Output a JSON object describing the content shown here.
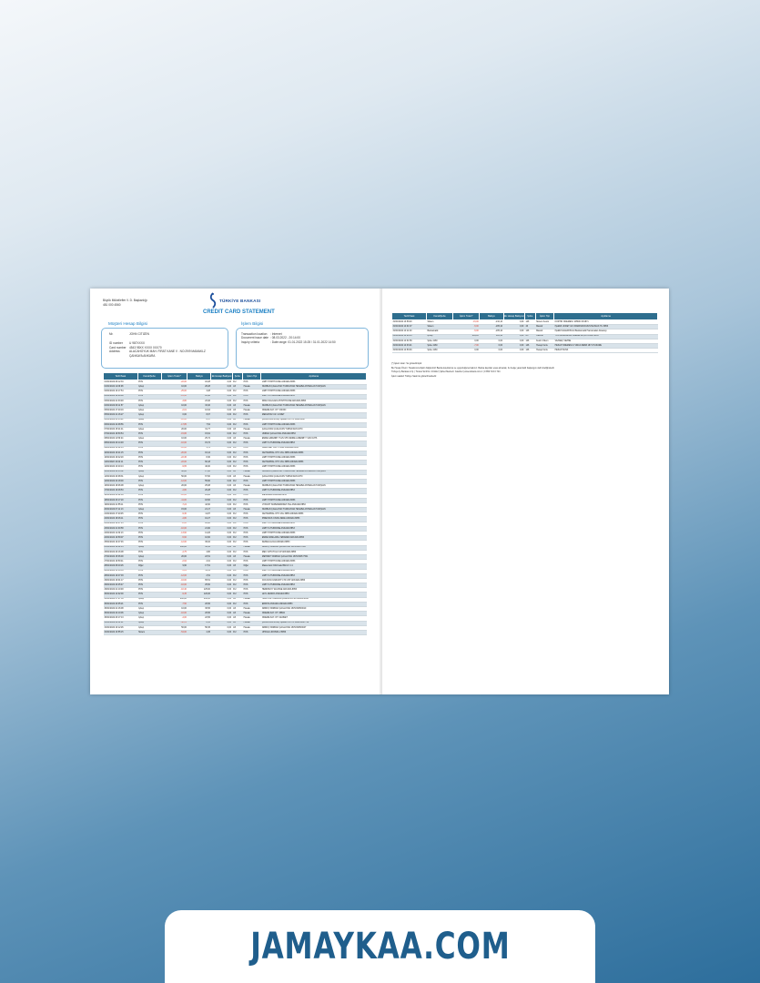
{
  "issuer": {
    "line1": "Büyük Mükellefler V. D. Başkanlığı",
    "line2": "481 000 4560"
  },
  "logo": {
    "text": "TÜRKİYE BANKASI",
    "icon": "bank-logo-icon",
    "color": "#1c4f9c"
  },
  "title": "CREDIT CARD STATEMENT",
  "customer_box": {
    "title": "Müşteri Hesap Bilgisi",
    "name_label": "Mr.",
    "name_value": "JOHN CITIZEN",
    "id_label": "ID number",
    "id_value": "U 987XXXX",
    "card_label": "Card number",
    "card_value": "4543 98XX XXXX 0XX70",
    "address_label": "Address",
    "address_value": "ALACAHOYUK MAH. FIRAT KANE V . NO:29/9 MAMAKLZ ÇANKAYA ANKARA"
  },
  "statement_box": {
    "title": "İşlem Bilgisi",
    "location_label": "Transaction location",
    "location_value": ": Internet",
    "issue_label": "Document issue date",
    "issue_value": ": 08.03.2022 - 20:14:00",
    "criteria_label": "Inquiry criteria",
    "criteria_value": ": Date range: 01.01.2022 15:25 / 31.01.2022 14:50"
  },
  "columns": [
    "Tarih/Saat",
    "Kanal/Şube",
    "İşlem Tutarı*",
    "Bakiye",
    "Ek Hesap Bakiyesi",
    "Şube",
    "İşlem Tipi",
    "Açıklama"
  ],
  "rows": [
    [
      "01/01/2022 09:12:33",
      "POS",
      "-22,00",
      "18,28",
      "0,00",
      "DU",
      "POS",
      "LIMIT POSTHOUSE ANKARA 8653"
    ],
    [
      "01/01/2022 11:06:08",
      "İşCep",
      "10,00",
      "28,28",
      "0,00",
      "AX",
      "Havale",
      "NURBAN ÇAĞLAYAN TURNA'DAN HESABA ANTARLAN TAKIŞGİN"
    ],
    [
      "02/01/2022 10:17:54",
      "POS",
      "-25,00",
      "3,28",
      "0,00",
      "DU",
      "POS",
      "LIMIT POSTHOUSE ANKARA 8653"
    ],
    [
      "03/01/2022 18:28:08",
      "POS",
      "-13,60",
      "10,40",
      "0,00",
      "DU",
      "POS",
      "LIMIT FUTURPANE ANKARA 8853"
    ],
    [
      "03/01/2022 21:33:48",
      "POS",
      "-3,80",
      "23,40",
      "0,00",
      "DU",
      "POS",
      "DIMLI DALILAKA POSTHOUSE ANKARA 8853"
    ],
    [
      "04/01/2022 09:11:57",
      "İşCep",
      "10,00",
      "33,40",
      "0,00",
      "AX",
      "Havale",
      "NURBAN ÇAĞLAYAN TURNA'DAN HESABA ANTARLAN TAKIŞGİN"
    ],
    [
      "05/01/2022 17:40:19",
      "İşCep",
      "-2,01",
      "10,64",
      "0,00",
      "AX",
      "Havale",
      "ÖDEME KAY. OT: VISION"
    ],
    [
      "05/01/2022 21:16:27",
      "İşCep",
      "0,00",
      "8,07",
      "0,00",
      "DU",
      "POS",
      "MEDIAHAV UZ. UCRET"
    ],
    [
      "06/01/2022 21:15:21",
      "İşCep",
      "-10,00",
      "8,17",
      "0,00",
      "AX",
      "Havale",
      "ÇAĞLAYAN BORÇ İŞLEMİ OUT IL 1188/3580"
    ],
    [
      "06/01/2022 22:08:56",
      "POS",
      "-17,85",
      "7,54",
      "0,00",
      "DU",
      "POS",
      "LIMIT POSTHOUSE ANKARA 8653"
    ],
    [
      "07/01/2022 15:21:41",
      "İşCep",
      "20,00",
      "31,77",
      "0,00",
      "AX",
      "Havale",
      "ÇAĞLAYAN ÇAĞLAYAN TURNA'DAN 1870"
    ],
    [
      "07/01/2022 18:50:54",
      "POS",
      "-15,86",
      "15,91",
      "0,00",
      "DU",
      "POS",
      "UMRAN ÇAĞLAYAN ANKARA 8853"
    ],
    [
      "08/01/2022 11:50:24",
      "İşCep",
      "10,00",
      "25,72",
      "0,00",
      "AX",
      "Havale",
      "EMRE AJRENBY YÜZÜ VP2 EMRE AJRENBY YÜZÜ 1876"
    ],
    [
      "08/01/2022 20:14:48",
      "POS",
      "-10,00",
      "15,72",
      "0,00",
      "DU",
      "POS",
      "LIMIT FUTURPANE ANKARA 8853"
    ],
    [
      "09/01/2022 13:42:13",
      "POS",
      "-10,00",
      "5,72",
      "0,00",
      "DU",
      "POS",
      "ÖREN BEY BAY 3 SOR ANKARA 8853"
    ],
    [
      "10/01/2022 16:21:15",
      "POS",
      "-20,00",
      "16,12",
      "0,00",
      "DU",
      "POS",
      "CEYNEPRAL OTO VAL 3985 ANKARA 8853"
    ],
    [
      "10/01/2022 19:42:20",
      "POS",
      "-22,36",
      "8,30",
      "0,00",
      "DU",
      "POS",
      "LIMIT POSTHOUSE ANKARA 8653"
    ],
    [
      "11/01/2022 10:22:11",
      "POS",
      "-22,00",
      "60,18",
      "0,00",
      "DU",
      "POS",
      "CEYNEPRAL OTO VAL 3985 ANKARA 8853"
    ],
    [
      "12/01/2022 13:40:13",
      "POS",
      "-9,65",
      "40,00",
      "0,00",
      "DU",
      "POS",
      "LIMIT POSTHOUSE ANKARA 8653"
    ],
    [
      "13/01/2022 20:13:32",
      "İşCep",
      "60,00",
      "17,60",
      "0,00",
      "AX",
      "Havale",
      "NURBAN ÇAĞLAYAN TURNA'DAN HESABA ANTARLAN TAKIŞGİN"
    ],
    [
      "14/01/2022 20:08:31",
      "İşCep",
      "50,00",
      "67,60",
      "0,00",
      "AX",
      "Havale",
      "ÇAĞLAYAN ÇAĞLAYAN TURNA'DAN 1870"
    ],
    [
      "14/01/2022 22:18:00",
      "POS",
      "-12,00",
      "55,60",
      "0,00",
      "DU",
      "POS",
      "LIMIT POSTHOUSE ANKARA 8653"
    ],
    [
      "16/01/2022 18:06:08",
      "İşCep",
      "20,00",
      "25,08",
      "0,00",
      "AX",
      "Havale",
      "NURBAN ÇAĞLAYAN TURNA'DAN HESABA ANTARLAN TAKIŞGİN"
    ],
    [
      "17/01/2022 19:48:53",
      "POS",
      "-4,80",
      "20,28",
      "0,00",
      "DU",
      "POS",
      "LIMIT FUTURPANE ANKARA 8853"
    ],
    [
      "18/01/2022 23:02:06",
      "POS",
      "-10,00",
      "29,60",
      "0,00",
      "DU",
      "POS",
      "MESAMBA ANKARA 8853"
    ],
    [
      "18/01/2022 23:17:20",
      "POS",
      "-11,00",
      "18,60",
      "0,00",
      "DU",
      "POS",
      "LIMIT POSTHOUSE ANKARA 8653"
    ],
    [
      "19/01/2022 21:55:11",
      "POS",
      "-7,24",
      "42,60",
      "0,00",
      "DU",
      "POS",
      "UYKURT SUPERMARKET-TEL ANKARA 8853"
    ],
    [
      "20/01/2022 07:11:13",
      "İşCep",
      "15,00",
      "21,17",
      "0,00",
      "AX",
      "Havale",
      "NURBAN ÇAĞLAYAN TURNA'DAN HESABA ANTARLAN TAKIŞGİN"
    ],
    [
      "21/01/2022 17:20:45",
      "POS",
      "-9,30",
      "11,87",
      "0,00",
      "DU",
      "POS",
      "CEYNEPRAL OTO VAL 3985 ANKARA 8853"
    ],
    [
      "22/01/2022 18:46:11",
      "POS",
      "-4,80",
      "10,27",
      "0,00",
      "DU",
      "POS",
      "PIREKSUS CIVAN ZENE ANKARA 8853"
    ],
    [
      "23/01/2022 19:07:45",
      "POS",
      "-8,00",
      "18,80",
      "0,00",
      "DU",
      "POS",
      "LIMIT FUTURPANE ANKARA 8853"
    ],
    [
      "23/01/2022 21:00:58",
      "POS",
      "-10,00",
      "21,90",
      "0,00",
      "DU",
      "POS",
      "LIMIT FUTURPANE ANKARA 8853"
    ],
    [
      "24/01/2022 11:32:13",
      "POS",
      "-13,60",
      "14,26",
      "0,00",
      "DU",
      "POS",
      "LIMIT POSTHOUSE ANKARA 8653"
    ],
    [
      "24/01/2022 19:59:07",
      "POS",
      "-5,60",
      "10,60",
      "0,00",
      "DU",
      "POS",
      "EMRE DAMLAMA-YEBAREM ANKARA 8853"
    ],
    [
      "25/01/2022 10:47:46",
      "POS",
      "-12,00",
      "36,02",
      "0,00",
      "DU",
      "POS",
      "KESMA ALICA ANKARA 8853"
    ],
    [
      "25/01/2022 18:42:13",
      "İşCep",
      "100,00",
      "36,52",
      "0,00",
      "AX",
      "Havale",
      "ABDUŞ TAIRDAN ÇAĞLAYAN 1870/2005 TBB"
    ],
    [
      "26/01/2022 20:16:08",
      "POS",
      "-4,75",
      "4,80",
      "0,00",
      "DU",
      "POS",
      "MEC ÖZTUTULU UP ANKARA 8853"
    ],
    [
      "27/01/2022 15:36:00",
      "İşCep",
      "20,00",
      "22,51",
      "0,00",
      "AX",
      "Havale",
      "MEHMET TAIRDAN ÇAĞLAYAN 1870/2005 7501"
    ],
    [
      "27/01/2022 19:50:41",
      "POS",
      "-2,62",
      "2,01",
      "0,00",
      "DU",
      "POS",
      "LIMIT POSTHOUSE ANKARA 8653"
    ],
    [
      "28/01/2022 08:40:26",
      "Diğer",
      "9,90",
      "17,51",
      "0,00",
      "AX",
      "Diğer",
      "Mastercard Ödül İade Bilimi 0 1.1"
    ],
    [
      "28/01/2022 15:16:33",
      "POS",
      "-5,81",
      "11,51",
      "0,00",
      "DU",
      "POS",
      "LIMIT FUTURPANE ANKARA 8853"
    ],
    [
      "28/01/2022 19:47:03",
      "POS",
      "-12,00",
      "2,51",
      "0,00",
      "DU",
      "POS",
      "LIMIT FUTURPANE ANKARA 8853"
    ],
    [
      "29/01/2022 19:01:17",
      "POS",
      "-16,00",
      "65,51",
      "0,00",
      "DU",
      "POS",
      "COCUUN KLMDÜNT LTD ÜST ANKARA 8853"
    ],
    [
      "29/01/2022 20:25:47",
      "POS",
      "-10,00",
      "25,50",
      "0,00",
      "DU",
      "POS",
      "LIMIT FUTURPANE ANKARA 8853"
    ],
    [
      "29/01/2022 21:10:48",
      "POS",
      "-10,40",
      "125,00",
      "0,00",
      "DU",
      "POS",
      "HERMSAYY ECZANE ANKARA 8853"
    ],
    [
      "30/01/2022 14:02:00",
      "POS",
      "-9,45",
      "120,06",
      "0,00",
      "DU",
      "POS",
      "LEYL ZENDO ANKARA 8853"
    ],
    [
      "30/01/2022 17:27:36",
      "İşCep",
      "800,00",
      "260,06",
      "0,00",
      "AX",
      "Havale",
      "HAMITOR TAIRDAN ÇAĞLAYAN 1870/2005/0010"
    ],
    [
      "30/01/2022 20:05:21",
      "POS",
      "-7,50",
      "26,56",
      "0,00",
      "DU",
      "POS",
      "ERDOS ANKARA ANKARA 8853"
    ],
    [
      "30/01/2022 21:16:08",
      "İşCep",
      "10,00",
      "36,56",
      "0,00",
      "AX",
      "Havale",
      "ABDUŞ TAIRDAN ÇAĞLAYAN 1870/2005/0010"
    ],
    [
      "30/01/2022 22:10:06",
      "İşCep",
      "-10,00",
      "26,56",
      "0,00",
      "AX",
      "Havale",
      "ÖDEME KAY. OT: 38802"
    ],
    [
      "30/01/2022 23:17:13",
      "İşCep",
      "-4,00",
      "22,56",
      "0,00",
      "AX",
      "Havale",
      "ÖDEME KAY. OT: CENNET"
    ],
    [
      "31/01/2022 09:11:41",
      "İşCep",
      "-48,01",
      "8,55",
      "0,00",
      "AX",
      "Havale",
      "ÇAĞLAYAN BORÇ İŞLEMİ OUT IL 1188/3580 758"
    ],
    [
      "31/01/2022 10:12:26",
      "İşCep",
      "50,00",
      "58,45",
      "0,00",
      "AX",
      "Havale",
      "ABDUŞ TAIRDAN ÇAĞLAYAN 1870/2005/0047"
    ],
    [
      "31/01/2022 13:55:15",
      "Sistem",
      "-54,00",
      "4,45",
      "0,00",
      "DU",
      "POS",
      "UPFILE LIDINSKLU 8853"
    ]
  ],
  "right_rows": [
    [
      "31/01/2022 13:59:20",
      "Sistem",
      "-15,00",
      "-210,10",
      "0,00",
      "146",
      "Sistem Kesim",
      "KORTIN ÖDEMESİ: 205M0 15/1871"
    ],
    [
      "31/01/2022 14:01:37",
      "Sistem",
      "-5,00",
      "-205,10",
      "0,00",
      "46",
      "Masraf",
      "İŞLEMİ ÜCRET İLK ORMANKODUUSHAUSLIK TİL 8853"
    ],
    [
      "31/01/2022 14:11:40",
      "Bankamatik",
      "-5,00",
      "-205,10",
      "0,00",
      "146",
      "Masraf",
      "İŞLEM KALEM BİLGİ Bankamatik Harcamaları Aksarayı"
    ],
    [
      "31/01/2022 14:20:13",
      "İşCep",
      "205,10",
      "205,10",
      "0,00",
      "AX",
      "Ödeme",
      "T.KU MASRAFLM ÖDEME 205,10 OĞUL MUN"
    ],
    [
      "31/01/2022 14:31:59",
      "Şube 4160",
      "0,00",
      "0,00",
      "0,00",
      "146",
      "Kesim Ödem",
      "VAZGEÇ VEZNE"
    ],
    [
      "31/01/2022 14:33:21",
      "Şube 4160",
      "-7,00",
      "0,00",
      "0,00",
      "146",
      "Hesap Kurtu",
      "HESAP ÖDEMESİ Ü VİRAJ MEBZ 1871 HUZURE"
    ],
    [
      "31/01/2022 14:50:46",
      "Şube 4160",
      "0,00",
      "0,00",
      "0,00",
      "146",
      "Hesap Kurtu",
      "HESAP KÜNK"
    ]
  ],
  "notes": {
    "line1": "(*) İşlem tutarı: Su gösterilmiştir.",
    "line2": "Bu Hesap Özeti / Hesabınıza ilişkin bilgilerinizi Banka kayıtlarına ve uygunluğuna bakınız. Banka kayıtları esas alınacak, bu belge yasal delil başlangıcı delil niteliğindedir.",
    "line3": "Türkiye İş Bankası A.Ş. | Ticaret Sicil No: 431112 | Şirket Merkezi: İstanbul | www.isbank.com.tr | 0 850 724 0 724",
    "line4": "İşlem saatleri Türkiye Saati ile gösterilmektedir."
  },
  "watermark": "JAMAYKAA.COM",
  "colors": {
    "header_bg": "#2e6e8e",
    "accent": "#1a7fc4",
    "negative": "#d43a2a",
    "brand": "#1f5e8c"
  }
}
